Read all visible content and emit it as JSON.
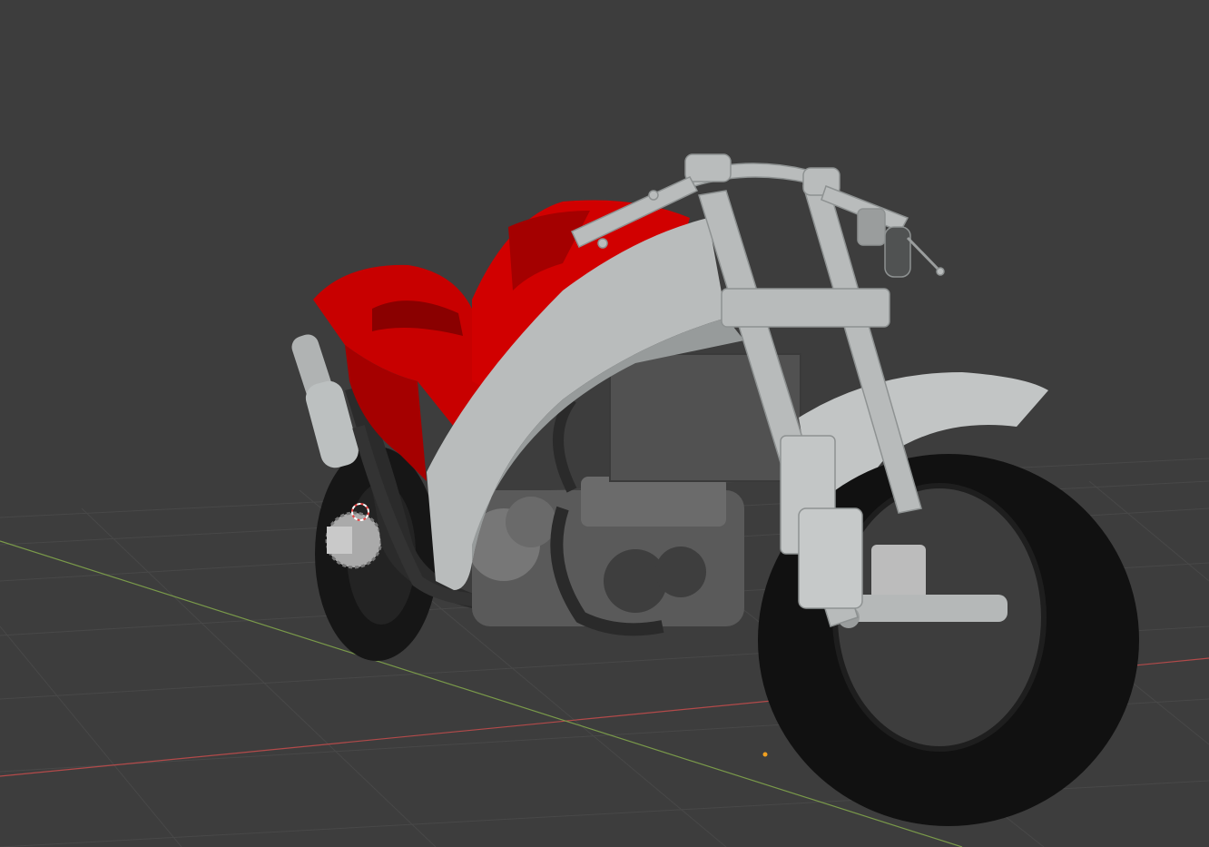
{
  "viewport": {
    "mode": "3d-viewport",
    "background_color": "#3d3d3d",
    "grid_color": "#4a4a4a",
    "x_axis_color": "#b34a4a",
    "y_axis_color": "#7a9a4a"
  },
  "scene": {
    "object": "motorcycle-model",
    "colors": {
      "body_red": "#c80000",
      "body_red_dark": "#8a0000",
      "frame_gray": "#b9bcbc",
      "frame_gray_dark": "#8f9393",
      "tire_black": "#161616",
      "engine_dark": "#4a4a4a",
      "engine_mid": "#6b6b6b",
      "radiator": "#505050"
    }
  },
  "cursor_3d": {
    "icon": "3d-cursor-icon",
    "color": "#e64545"
  },
  "origin_point": {
    "icon": "origin-dot-icon",
    "color": "#f0a020"
  }
}
